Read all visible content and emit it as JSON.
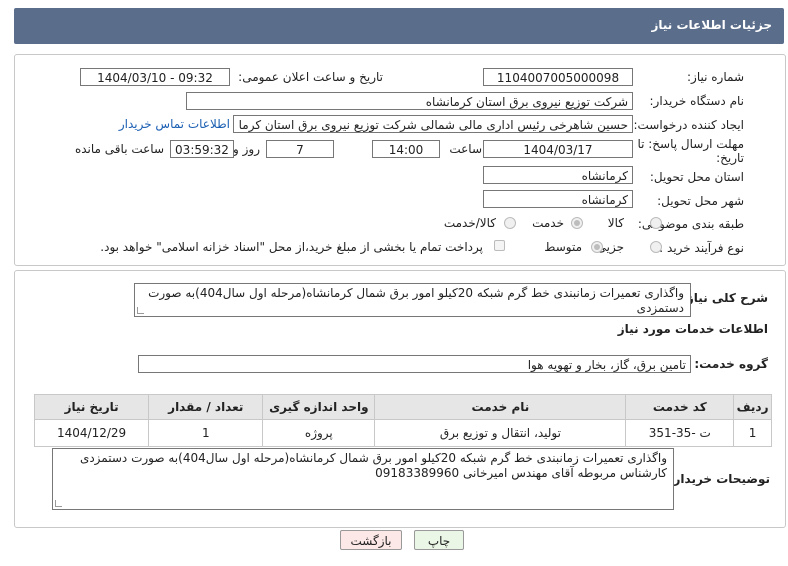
{
  "header": {
    "title": "جزئیات اطلاعات نیاز"
  },
  "fields": {
    "need_number_label": "شماره نیاز:",
    "need_number": "1104007005000098",
    "announce_label": "تاریخ و ساعت اعلان عمومی:",
    "announce_value": "1404/03/10 - 09:32",
    "buyer_org_label": "نام دستگاه خریدار:",
    "buyer_org": "شرکت توزیع نیروی برق استان کرمانشاه",
    "creator_label": "ایجاد کننده درخواست:",
    "creator": "حسین شاهرخی رئیس اداری مالی شمالی شرکت توزیع نیروی برق استان کرما",
    "contact_link": "اطلاعات تماس خریدار",
    "deadline_label_1": "مهلت ارسال پاسخ: تا",
    "deadline_label_2": "تاریخ:",
    "deadline_date": "1404/03/17",
    "time_label": "ساعت",
    "deadline_time": "14:00",
    "days_value": "7",
    "days_label": "روز و",
    "remaining_time": "03:59:32",
    "remaining_label": "ساعت باقی مانده",
    "province_label": "استان محل تحویل:",
    "province": "کرمانشاه",
    "city_label": "شهر محل تحویل:",
    "city": "کرمانشاه",
    "category_label": "طبقه بندی موضوعی:",
    "category_options": [
      "کالا",
      "خدمت",
      "کالا/خدمت"
    ],
    "process_label": "نوع فرآیند خرید :",
    "process_options": [
      "جزیی",
      "متوسط"
    ],
    "payment_note": "پرداخت تمام یا بخشی از مبلغ خرید،از محل \"اسناد خزانه اسلامی\" خواهد بود."
  },
  "description": {
    "label": "شرح کلی نیاز:",
    "text": "واگذاری تعمیرات زمانبندی خط گرم شبکه 20کیلو امور برق شمال کرمانشاه(مرحله اول سال404)به صورت دستمزدی"
  },
  "services": {
    "section_title": "اطلاعات خدمات مورد نیاز",
    "group_label": "گروه خدمت:",
    "group_value": "تامین برق، گاز، بخار و تهویه هوا",
    "columns": [
      "ردیف",
      "کد خدمت",
      "نام خدمت",
      "واحد اندازه گیری",
      "تعداد / مقدار",
      "تاریخ نیاز"
    ],
    "rows": [
      {
        "index": "1",
        "code": "ت -35-351",
        "name": "تولید، انتقال و توزیع برق",
        "unit": "پروژه",
        "qty": "1",
        "date": "1404/12/29"
      }
    ]
  },
  "buyer_notes": {
    "label": "توضیحات خریدار:",
    "line1": "واگذاری تعمیرات زمانبندی خط گرم شبکه 20کیلو امور برق شمال کرمانشاه(مرحله اول سال404)به صورت دستمزدی",
    "line2": "کارشناس مربوطه آقای مهندس امیرخانی 09183389960"
  },
  "buttons": {
    "print": "چاپ",
    "back": "بازگشت"
  },
  "colors": {
    "header": "#5a6e8c",
    "back_button": "#fde8e8",
    "print_button": "#eaf7e6",
    "watermark": "#e8a8a8"
  }
}
